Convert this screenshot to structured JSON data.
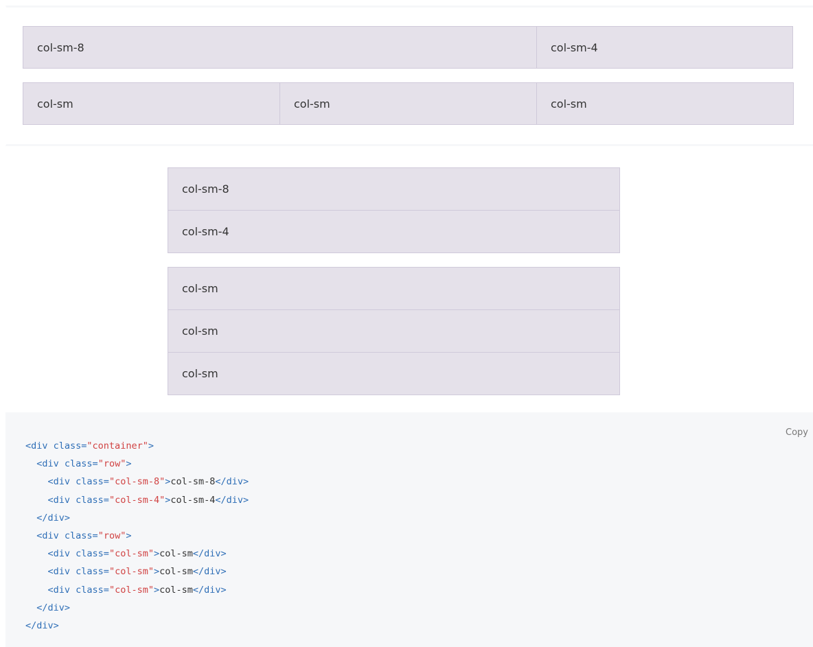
{
  "example_wide": {
    "row1": [
      "col-sm-8",
      "col-sm-4"
    ],
    "row2": [
      "col-sm",
      "col-sm",
      "col-sm"
    ]
  },
  "example_narrow": {
    "stack1": [
      "col-sm-8",
      "col-sm-4"
    ],
    "stack2": [
      "col-sm",
      "col-sm",
      "col-sm"
    ]
  },
  "code_block": {
    "copy_label": "Copy",
    "lines": [
      {
        "indent": "",
        "open": "<div",
        "attr": " class=",
        "val": "\"container\"",
        "close": ">",
        "text": "",
        "end": ""
      },
      {
        "indent": "  ",
        "open": "<div",
        "attr": " class=",
        "val": "\"row\"",
        "close": ">",
        "text": "",
        "end": ""
      },
      {
        "indent": "    ",
        "open": "<div",
        "attr": " class=",
        "val": "\"col-sm-8\"",
        "close": ">",
        "text": "col-sm-8",
        "end": "</div>"
      },
      {
        "indent": "    ",
        "open": "<div",
        "attr": " class=",
        "val": "\"col-sm-4\"",
        "close": ">",
        "text": "col-sm-4",
        "end": "</div>"
      },
      {
        "indent": "  ",
        "open": "</div>",
        "attr": "",
        "val": "",
        "close": "",
        "text": "",
        "end": ""
      },
      {
        "indent": "  ",
        "open": "<div",
        "attr": " class=",
        "val": "\"row\"",
        "close": ">",
        "text": "",
        "end": ""
      },
      {
        "indent": "    ",
        "open": "<div",
        "attr": " class=",
        "val": "\"col-sm\"",
        "close": ">",
        "text": "col-sm",
        "end": "</div>"
      },
      {
        "indent": "    ",
        "open": "<div",
        "attr": " class=",
        "val": "\"col-sm\"",
        "close": ">",
        "text": "col-sm",
        "end": "</div>"
      },
      {
        "indent": "    ",
        "open": "<div",
        "attr": " class=",
        "val": "\"col-sm\"",
        "close": ">",
        "text": "col-sm",
        "end": "</div>"
      },
      {
        "indent": "  ",
        "open": "</div>",
        "attr": "",
        "val": "",
        "close": "",
        "text": "",
        "end": ""
      },
      {
        "indent": "",
        "open": "</div>",
        "attr": "",
        "val": "",
        "close": "",
        "text": "",
        "end": ""
      }
    ]
  },
  "colors": {
    "cell_bg": "#e5e1ea",
    "cell_border": "#cfc9da",
    "code_bg": "#f6f7f9",
    "code_tag": "#2f6fb7",
    "code_string": "#d14343"
  }
}
